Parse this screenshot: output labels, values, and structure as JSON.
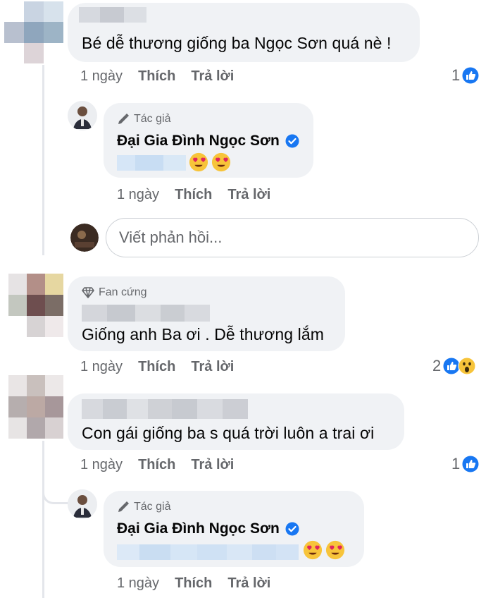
{
  "comments": [
    {
      "text": "Bé dễ thương giống ba Ngọc Sơn quá nè !",
      "time": "1 ngày",
      "like": "Thích",
      "reply": "Trả lời",
      "reactions": "1",
      "reply_item": {
        "badge": "Tác giả",
        "name": "Đại Gia Đình Ngọc Sơn",
        "time": "1 ngày",
        "like": "Thích",
        "reply": "Trả lời"
      },
      "reply_placeholder": "Viết phản hồi..."
    },
    {
      "badge": "Fan cứng",
      "text": "Giống anh Ba ơi . Dễ thương lắm",
      "time": "1 ngày",
      "like": "Thích",
      "reply": "Trả lời",
      "reactions": "2"
    },
    {
      "text": "Con gái giống ba s quá trời luôn a trai ơi",
      "time": "1 ngày",
      "like": "Thích",
      "reply": "Trả lời",
      "reactions": "1",
      "reply_item": {
        "badge": "Tác giả",
        "name": "Đại Gia Đình Ngọc Sơn",
        "time": "1 ngày",
        "like": "Thích",
        "reply": "Trả lời"
      }
    }
  ],
  "colors": {
    "bubble": "#f0f2f5",
    "meta_text": "#65676b",
    "like_blue": "#1877f2",
    "verified_blue": "#1877f2"
  },
  "icons": [
    "like-icon",
    "wow-icon",
    "heart-eyes-icon",
    "pencil-icon",
    "diamond-icon",
    "verified-icon"
  ]
}
